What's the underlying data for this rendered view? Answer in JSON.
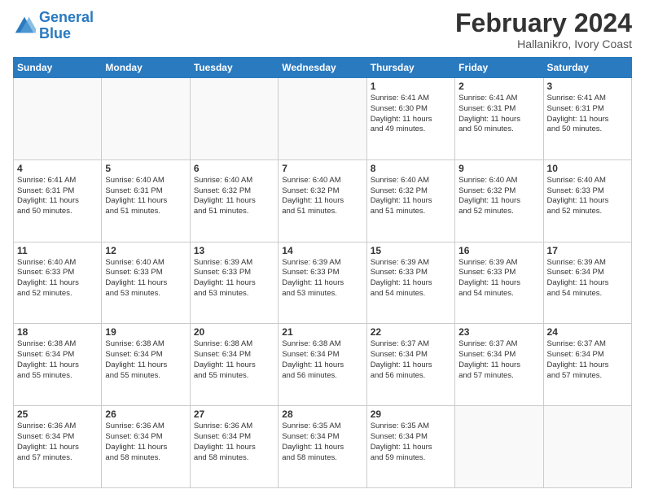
{
  "logo": {
    "text1": "General",
    "text2": "Blue"
  },
  "header": {
    "month": "February 2024",
    "location": "Hallanikro, Ivory Coast"
  },
  "weekdays": [
    "Sunday",
    "Monday",
    "Tuesday",
    "Wednesday",
    "Thursday",
    "Friday",
    "Saturday"
  ],
  "weeks": [
    [
      {
        "day": "",
        "info": ""
      },
      {
        "day": "",
        "info": ""
      },
      {
        "day": "",
        "info": ""
      },
      {
        "day": "",
        "info": ""
      },
      {
        "day": "1",
        "info": "Sunrise: 6:41 AM\nSunset: 6:30 PM\nDaylight: 11 hours\nand 49 minutes."
      },
      {
        "day": "2",
        "info": "Sunrise: 6:41 AM\nSunset: 6:31 PM\nDaylight: 11 hours\nand 50 minutes."
      },
      {
        "day": "3",
        "info": "Sunrise: 6:41 AM\nSunset: 6:31 PM\nDaylight: 11 hours\nand 50 minutes."
      }
    ],
    [
      {
        "day": "4",
        "info": "Sunrise: 6:41 AM\nSunset: 6:31 PM\nDaylight: 11 hours\nand 50 minutes."
      },
      {
        "day": "5",
        "info": "Sunrise: 6:40 AM\nSunset: 6:31 PM\nDaylight: 11 hours\nand 51 minutes."
      },
      {
        "day": "6",
        "info": "Sunrise: 6:40 AM\nSunset: 6:32 PM\nDaylight: 11 hours\nand 51 minutes."
      },
      {
        "day": "7",
        "info": "Sunrise: 6:40 AM\nSunset: 6:32 PM\nDaylight: 11 hours\nand 51 minutes."
      },
      {
        "day": "8",
        "info": "Sunrise: 6:40 AM\nSunset: 6:32 PM\nDaylight: 11 hours\nand 51 minutes."
      },
      {
        "day": "9",
        "info": "Sunrise: 6:40 AM\nSunset: 6:32 PM\nDaylight: 11 hours\nand 52 minutes."
      },
      {
        "day": "10",
        "info": "Sunrise: 6:40 AM\nSunset: 6:33 PM\nDaylight: 11 hours\nand 52 minutes."
      }
    ],
    [
      {
        "day": "11",
        "info": "Sunrise: 6:40 AM\nSunset: 6:33 PM\nDaylight: 11 hours\nand 52 minutes."
      },
      {
        "day": "12",
        "info": "Sunrise: 6:40 AM\nSunset: 6:33 PM\nDaylight: 11 hours\nand 53 minutes."
      },
      {
        "day": "13",
        "info": "Sunrise: 6:39 AM\nSunset: 6:33 PM\nDaylight: 11 hours\nand 53 minutes."
      },
      {
        "day": "14",
        "info": "Sunrise: 6:39 AM\nSunset: 6:33 PM\nDaylight: 11 hours\nand 53 minutes."
      },
      {
        "day": "15",
        "info": "Sunrise: 6:39 AM\nSunset: 6:33 PM\nDaylight: 11 hours\nand 54 minutes."
      },
      {
        "day": "16",
        "info": "Sunrise: 6:39 AM\nSunset: 6:33 PM\nDaylight: 11 hours\nand 54 minutes."
      },
      {
        "day": "17",
        "info": "Sunrise: 6:39 AM\nSunset: 6:34 PM\nDaylight: 11 hours\nand 54 minutes."
      }
    ],
    [
      {
        "day": "18",
        "info": "Sunrise: 6:38 AM\nSunset: 6:34 PM\nDaylight: 11 hours\nand 55 minutes."
      },
      {
        "day": "19",
        "info": "Sunrise: 6:38 AM\nSunset: 6:34 PM\nDaylight: 11 hours\nand 55 minutes."
      },
      {
        "day": "20",
        "info": "Sunrise: 6:38 AM\nSunset: 6:34 PM\nDaylight: 11 hours\nand 55 minutes."
      },
      {
        "day": "21",
        "info": "Sunrise: 6:38 AM\nSunset: 6:34 PM\nDaylight: 11 hours\nand 56 minutes."
      },
      {
        "day": "22",
        "info": "Sunrise: 6:37 AM\nSunset: 6:34 PM\nDaylight: 11 hours\nand 56 minutes."
      },
      {
        "day": "23",
        "info": "Sunrise: 6:37 AM\nSunset: 6:34 PM\nDaylight: 11 hours\nand 57 minutes."
      },
      {
        "day": "24",
        "info": "Sunrise: 6:37 AM\nSunset: 6:34 PM\nDaylight: 11 hours\nand 57 minutes."
      }
    ],
    [
      {
        "day": "25",
        "info": "Sunrise: 6:36 AM\nSunset: 6:34 PM\nDaylight: 11 hours\nand 57 minutes."
      },
      {
        "day": "26",
        "info": "Sunrise: 6:36 AM\nSunset: 6:34 PM\nDaylight: 11 hours\nand 58 minutes."
      },
      {
        "day": "27",
        "info": "Sunrise: 6:36 AM\nSunset: 6:34 PM\nDaylight: 11 hours\nand 58 minutes."
      },
      {
        "day": "28",
        "info": "Sunrise: 6:35 AM\nSunset: 6:34 PM\nDaylight: 11 hours\nand 58 minutes."
      },
      {
        "day": "29",
        "info": "Sunrise: 6:35 AM\nSunset: 6:34 PM\nDaylight: 11 hours\nand 59 minutes."
      },
      {
        "day": "",
        "info": ""
      },
      {
        "day": "",
        "info": ""
      }
    ]
  ]
}
